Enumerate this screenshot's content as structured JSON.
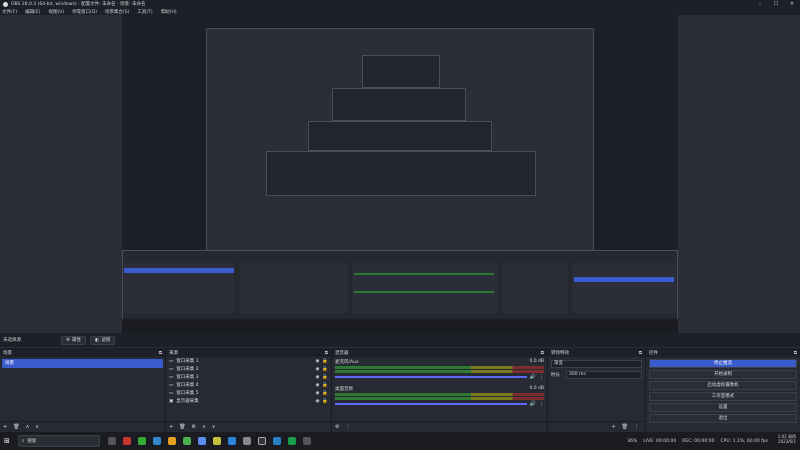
{
  "window": {
    "title": "OBS 28.0.3 (64-bit, windows) - 配置文件: 未命名 - 场景: 未命名"
  },
  "menu": [
    "文件(F)",
    "编辑(E)",
    "视图(V)",
    "停靠窗口(D)",
    "场景集合(S)",
    "工具(T)",
    "帮助(H)"
  ],
  "context": {
    "no_source": "未选择源",
    "properties": "属性",
    "filters": "滤镜"
  },
  "scenes": {
    "title": "场景",
    "items": [
      "场景"
    ]
  },
  "sources": {
    "title": "来源",
    "items": [
      "窗口采集 1",
      "窗口采集 2",
      "窗口采集 3",
      "窗口采集 4",
      "窗口采集 5",
      "显示器采集"
    ]
  },
  "mixer": {
    "title": "混音器",
    "channels": [
      {
        "name": "麦克风/Aux",
        "db": "0.0 dB"
      },
      {
        "name": "桌面音频",
        "db": "0.0 dB"
      }
    ]
  },
  "transitions": {
    "title": "转场特效",
    "type": "渐变",
    "duration_label": "时长",
    "duration": "300 ms"
  },
  "controls": {
    "title": "控件",
    "buttons": [
      "停止推流",
      "开始录制",
      "启动虚拟摄像机",
      "工作室模式",
      "设置",
      "退出"
    ]
  },
  "status": {
    "live": "LIVE: 00:00:00",
    "rec": "REC: 00:00:00",
    "cpu": "CPU: 1.1%, 60.00 fps",
    "fps_pct": "36%"
  },
  "taskbar": {
    "search": "搜索",
    "time": "1:02 周四",
    "date": "2023/6/1"
  },
  "colors": {
    "accent": "#3b5ccc",
    "bg": "#2b2e38",
    "panel": "#272a33"
  }
}
